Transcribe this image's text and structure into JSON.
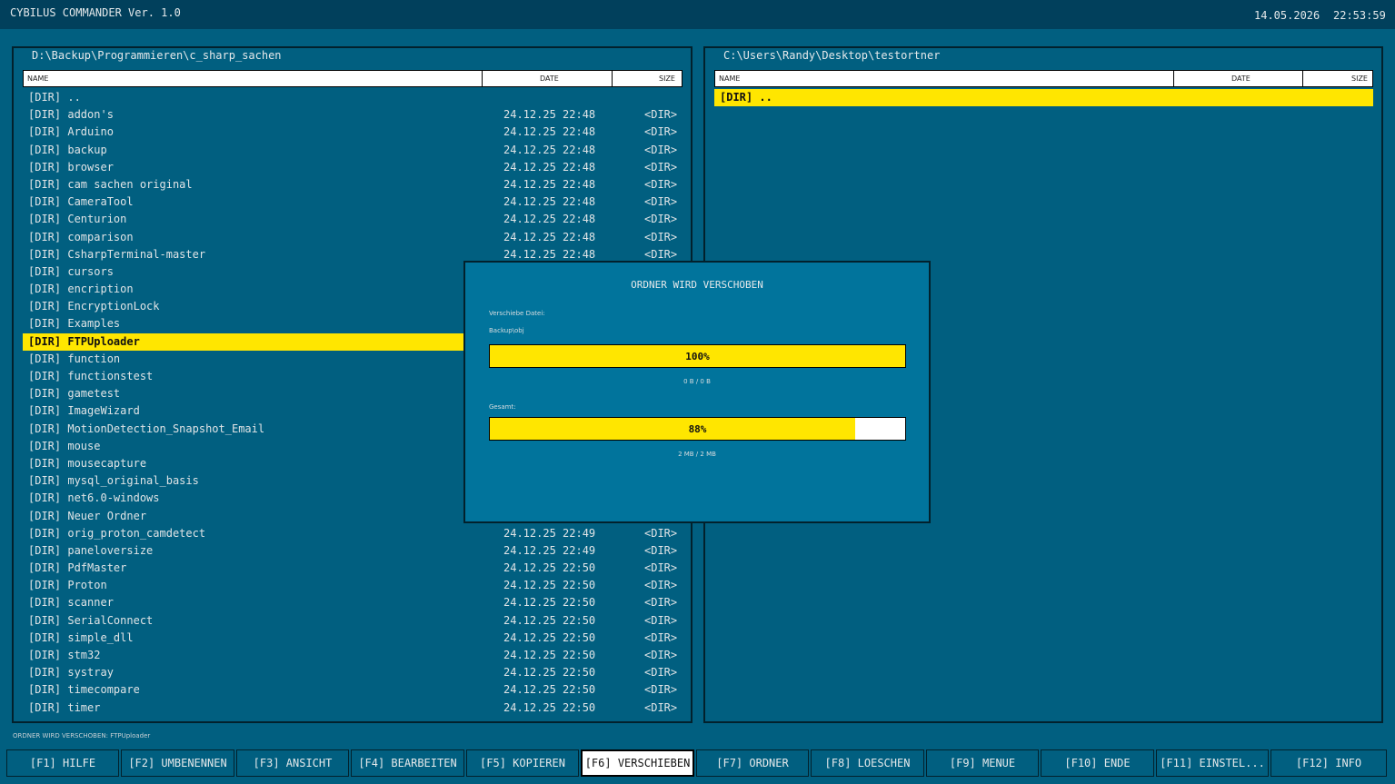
{
  "app": {
    "title": "CYBILUS COMMANDER Ver. 1.0",
    "date": "14.05.2026",
    "time": "22:53:59"
  },
  "left_panel": {
    "path": "D:\\Backup\\Programmieren\\c_sharp_sachen",
    "columns": {
      "name": "NAME",
      "date": "DATE",
      "size": "SIZE"
    },
    "rows": [
      {
        "name": "[DIR] ..",
        "date": "",
        "size": ""
      },
      {
        "name": "[DIR] addon's",
        "date": "24.12.25 22:48",
        "size": "<DIR>"
      },
      {
        "name": "[DIR] Arduino",
        "date": "24.12.25 22:48",
        "size": "<DIR>"
      },
      {
        "name": "[DIR] backup",
        "date": "24.12.25 22:48",
        "size": "<DIR>"
      },
      {
        "name": "[DIR] browser",
        "date": "24.12.25 22:48",
        "size": "<DIR>"
      },
      {
        "name": "[DIR] cam sachen original",
        "date": "24.12.25 22:48",
        "size": "<DIR>"
      },
      {
        "name": "[DIR] CameraTool",
        "date": "24.12.25 22:48",
        "size": "<DIR>"
      },
      {
        "name": "[DIR] Centurion",
        "date": "24.12.25 22:48",
        "size": "<DIR>"
      },
      {
        "name": "[DIR] comparison",
        "date": "24.12.25 22:48",
        "size": "<DIR>"
      },
      {
        "name": "[DIR] CsharpTerminal-master",
        "date": "24.12.25 22:48",
        "size": "<DIR>"
      },
      {
        "name": "[DIR] cursors",
        "date": "",
        "size": ""
      },
      {
        "name": "[DIR] encription",
        "date": "",
        "size": ""
      },
      {
        "name": "[DIR] EncryptionLock",
        "date": "",
        "size": ""
      },
      {
        "name": "[DIR] Examples",
        "date": "",
        "size": ""
      },
      {
        "name": "[DIR] FTPUploader",
        "date": "",
        "size": "",
        "selected": true
      },
      {
        "name": "[DIR] function",
        "date": "",
        "size": ""
      },
      {
        "name": "[DIR] functionstest",
        "date": "",
        "size": ""
      },
      {
        "name": "[DIR] gametest",
        "date": "",
        "size": ""
      },
      {
        "name": "[DIR] ImageWizard",
        "date": "",
        "size": ""
      },
      {
        "name": "[DIR] MotionDetection_Snapshot_Email",
        "date": "",
        "size": ""
      },
      {
        "name": "[DIR] mouse",
        "date": "",
        "size": ""
      },
      {
        "name": "[DIR] mousecapture",
        "date": "",
        "size": ""
      },
      {
        "name": "[DIR] mysql_original_basis",
        "date": "",
        "size": ""
      },
      {
        "name": "[DIR] net6.0-windows",
        "date": "",
        "size": ""
      },
      {
        "name": "[DIR] Neuer Ordner",
        "date": "",
        "size": ""
      },
      {
        "name": "[DIR] orig_proton_camdetect",
        "date": "24.12.25 22:49",
        "size": "<DIR>"
      },
      {
        "name": "[DIR] paneloversize",
        "date": "24.12.25 22:49",
        "size": "<DIR>"
      },
      {
        "name": "[DIR] PdfMaster",
        "date": "24.12.25 22:50",
        "size": "<DIR>"
      },
      {
        "name": "[DIR] Proton",
        "date": "24.12.25 22:50",
        "size": "<DIR>"
      },
      {
        "name": "[DIR] scanner",
        "date": "24.12.25 22:50",
        "size": "<DIR>"
      },
      {
        "name": "[DIR] SerialConnect",
        "date": "24.12.25 22:50",
        "size": "<DIR>"
      },
      {
        "name": "[DIR] simple_dll",
        "date": "24.12.25 22:50",
        "size": "<DIR>"
      },
      {
        "name": "[DIR] stm32",
        "date": "24.12.25 22:50",
        "size": "<DIR>"
      },
      {
        "name": "[DIR] systray",
        "date": "24.12.25 22:50",
        "size": "<DIR>"
      },
      {
        "name": "[DIR] timecompare",
        "date": "24.12.25 22:50",
        "size": "<DIR>"
      },
      {
        "name": "[DIR] timer",
        "date": "24.12.25 22:50",
        "size": "<DIR>"
      }
    ]
  },
  "right_panel": {
    "path": "C:\\Users\\Randy\\Desktop\\testortner",
    "columns": {
      "name": "NAME",
      "date": "DATE",
      "size": "SIZE"
    },
    "rows": [
      {
        "name": "[DIR] ..",
        "date": "",
        "size": "",
        "selected": true
      }
    ]
  },
  "dialog": {
    "title": "ORDNER WIRD VERSCHOBEN",
    "file_label": "Verschiebe Datei:",
    "file_name": "Backup\\obj",
    "file_progress": {
      "value": 100,
      "label": "100%",
      "detail": "0 B / 0 B"
    },
    "total_label": "Gesamt:",
    "total_progress": {
      "value": 88,
      "label": "88%",
      "detail": "2 MB / 2 MB"
    }
  },
  "status": "ORDNER WIRD VERSCHOBEN: FTPUploader",
  "function_keys": [
    {
      "label": "[F1] HILFE"
    },
    {
      "label": "[F2] UMBENENNEN"
    },
    {
      "label": "[F3] ANSICHT"
    },
    {
      "label": "[F4] BEARBEITEN"
    },
    {
      "label": "[F5] KOPIEREN"
    },
    {
      "label": "[F6] VERSCHIEBEN",
      "active": true
    },
    {
      "label": "[F7] ORDNER"
    },
    {
      "label": "[F8] LOESCHEN"
    },
    {
      "label": "[F9] MENUE"
    },
    {
      "label": "[F10] ENDE"
    },
    {
      "label": "[F11] EINSTEL..."
    },
    {
      "label": "[F12] INFO"
    }
  ],
  "colors": {
    "background": "#015f80",
    "highlight": "#ffe600",
    "border": "#02212c"
  }
}
